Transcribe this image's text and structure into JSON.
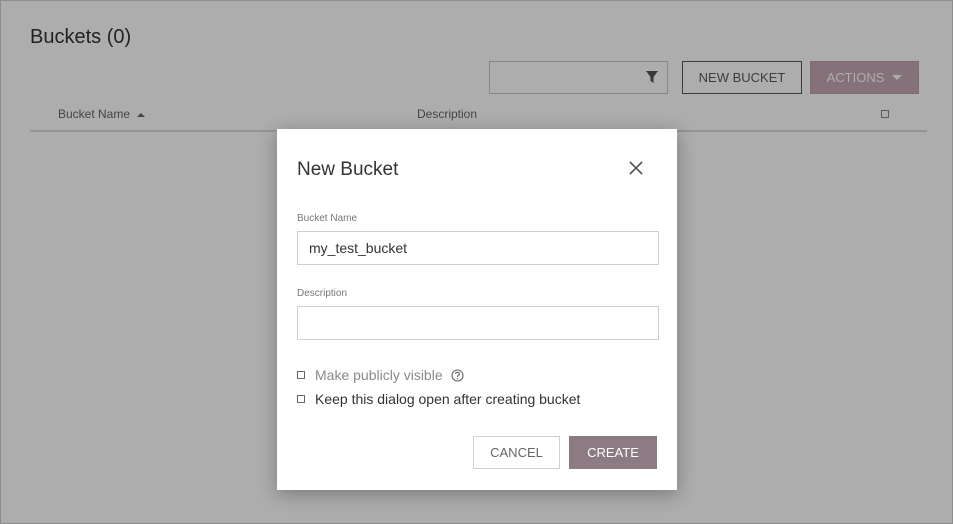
{
  "page": {
    "title": "Buckets (0)",
    "filter": {
      "value": "",
      "placeholder": ""
    },
    "new_bucket_label": "NEW BUCKET",
    "actions_label": "ACTIONS",
    "table": {
      "columns": [
        "Bucket Name",
        "Description"
      ],
      "sort_column": "Bucket Name",
      "sort_direction": "ascending",
      "rows": []
    }
  },
  "dialog": {
    "title": "New Bucket",
    "bucket_name_label": "Bucket Name",
    "bucket_name_value": "my_test_bucket",
    "description_label": "Description",
    "description_value": "",
    "public_label": "Make publicly visible",
    "public_checked": false,
    "keep_open_label": "Keep this dialog open after creating bucket",
    "keep_open_checked": false,
    "cancel_label": "CANCEL",
    "create_label": "CREATE"
  },
  "icons": {
    "filter": "filter-icon",
    "close": "close-icon",
    "help": "help-icon",
    "actions_caret": "caret-down-icon",
    "sort": "sort-up-icon"
  },
  "colors": {
    "accent": "#8c7b82",
    "actions_bg": "#c4a7b3"
  }
}
